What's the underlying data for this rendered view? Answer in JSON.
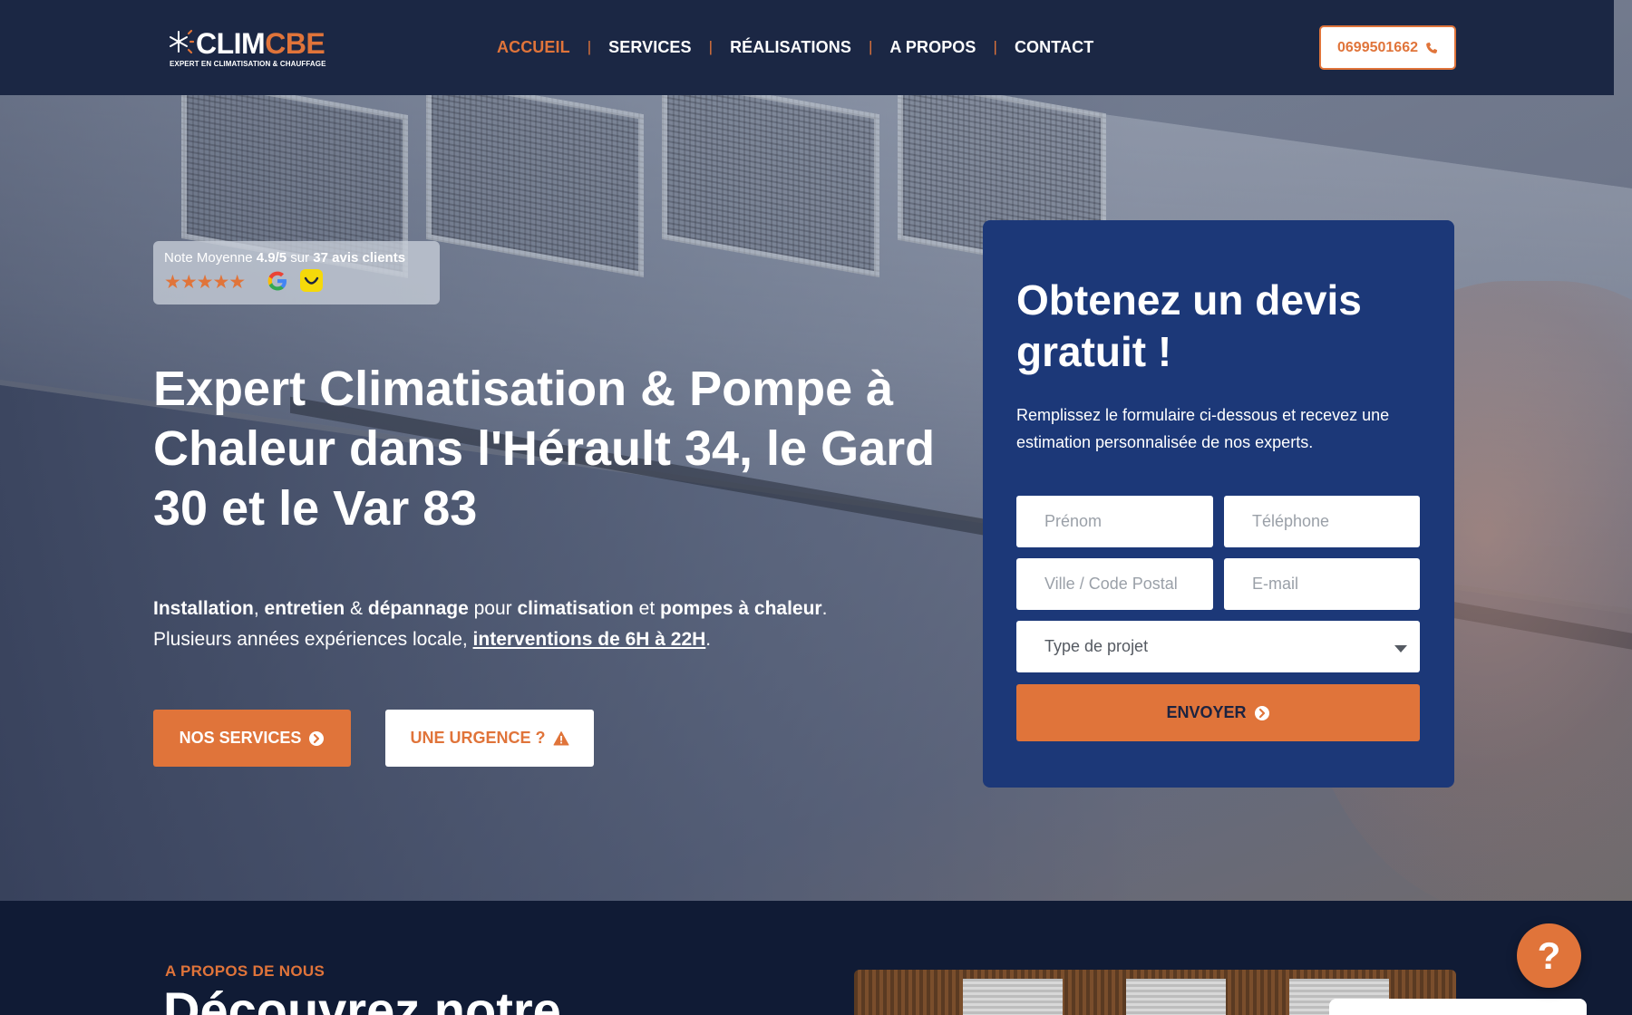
{
  "header": {
    "logo": {
      "brand_part1": "CLIM",
      "brand_part2": "CBE",
      "tagline": "EXPERT EN CLIMATISATION & CHAUFFAGE"
    },
    "nav": [
      {
        "label": "ACCUEIL",
        "active": true
      },
      {
        "label": "SERVICES",
        "active": false
      },
      {
        "label": "RÉALISATIONS",
        "active": false
      },
      {
        "label": "A PROPOS",
        "active": false
      },
      {
        "label": "CONTACT",
        "active": false
      }
    ],
    "nav_separator": "|",
    "phone": "0699501662",
    "phone_icon": "phone-icon"
  },
  "review": {
    "prefix": "Note Moyenne ",
    "score": "4.9/5",
    "middle": " sur ",
    "count": "37 avis clients",
    "stars": "★★★★★",
    "icons": [
      "google-icon",
      "smile-icon"
    ]
  },
  "hero": {
    "title": "Expert Climatisation & Pompe à Chaleur dans l'Hérault 34, le Gard 30 et le Var 83",
    "desc": {
      "w1": "Installation",
      "t1": ", ",
      "w2": "entretien",
      "t2": " & ",
      "w3": "dépannage",
      "t3": " pour ",
      "w4": "climatisation",
      "t4": " et ",
      "w5": "pompes à chaleur",
      "t5": ".",
      "line2_prefix": "Plusieurs années expériences locale, ",
      "line2_link": "interventions de 6H à 22H",
      "line2_suffix": "."
    },
    "btn_services": "NOS SERVICES",
    "btn_urgence": "UNE URGENCE ?"
  },
  "quote": {
    "title": "Obtenez un devis gratuit !",
    "desc": "Remplissez le formulaire ci-dessous et recevez une estimation personnalisée de nos experts.",
    "fields": {
      "prenom": "Prénom",
      "telephone": "Téléphone",
      "ville": "Ville / Code Postal",
      "email": "E-mail",
      "type": "Type de projet"
    },
    "submit": "ENVOYER"
  },
  "about": {
    "label": "A PROPOS DE NOUS",
    "title": "Découvrez notre"
  },
  "help": {
    "label": "?"
  },
  "colors": {
    "accent": "#e0743a",
    "header_bg": "#1b2744",
    "form_bg": "#1c3878",
    "section_bg": "#101b35"
  }
}
